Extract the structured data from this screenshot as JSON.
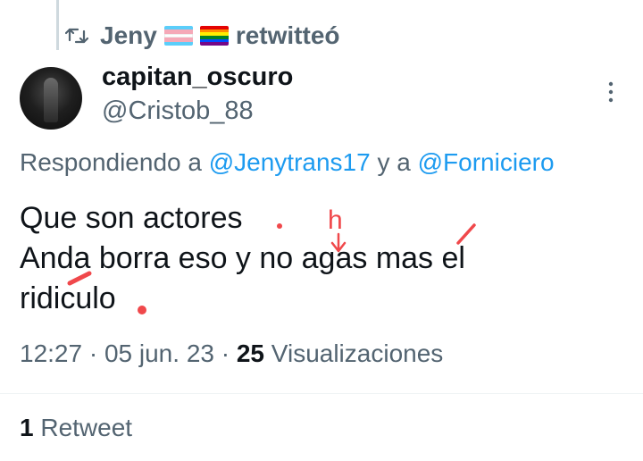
{
  "retweet_header": {
    "icon": "retweet-icon",
    "user": "Jeny",
    "flags": [
      "transgender-flag",
      "rainbow-flag"
    ],
    "verb": "retwitteó"
  },
  "author": {
    "display_name": "capitan_oscuro",
    "handle": "@Cristob_88",
    "avatar": "avatar"
  },
  "more_icon": "more-vertical-icon",
  "replying": {
    "prefix": "Respondiendo a",
    "mention_1": "@Jenytrans17",
    "conjunction": "y a",
    "mention_2": "@Forniciero"
  },
  "tweet": {
    "line_1": "Que son actores",
    "line_2": "Anda borra eso y no agas mas el",
    "line_3": "ridiculo"
  },
  "annotations": {
    "letter": "h",
    "color": "#f0484b"
  },
  "meta": {
    "time": "12:27",
    "separator": "·",
    "date": "05 jun. 23",
    "views_count": "25",
    "views_label": "Visualizaciones"
  },
  "stats": {
    "retweets_count": "1",
    "retweets_label": "Retweet"
  }
}
